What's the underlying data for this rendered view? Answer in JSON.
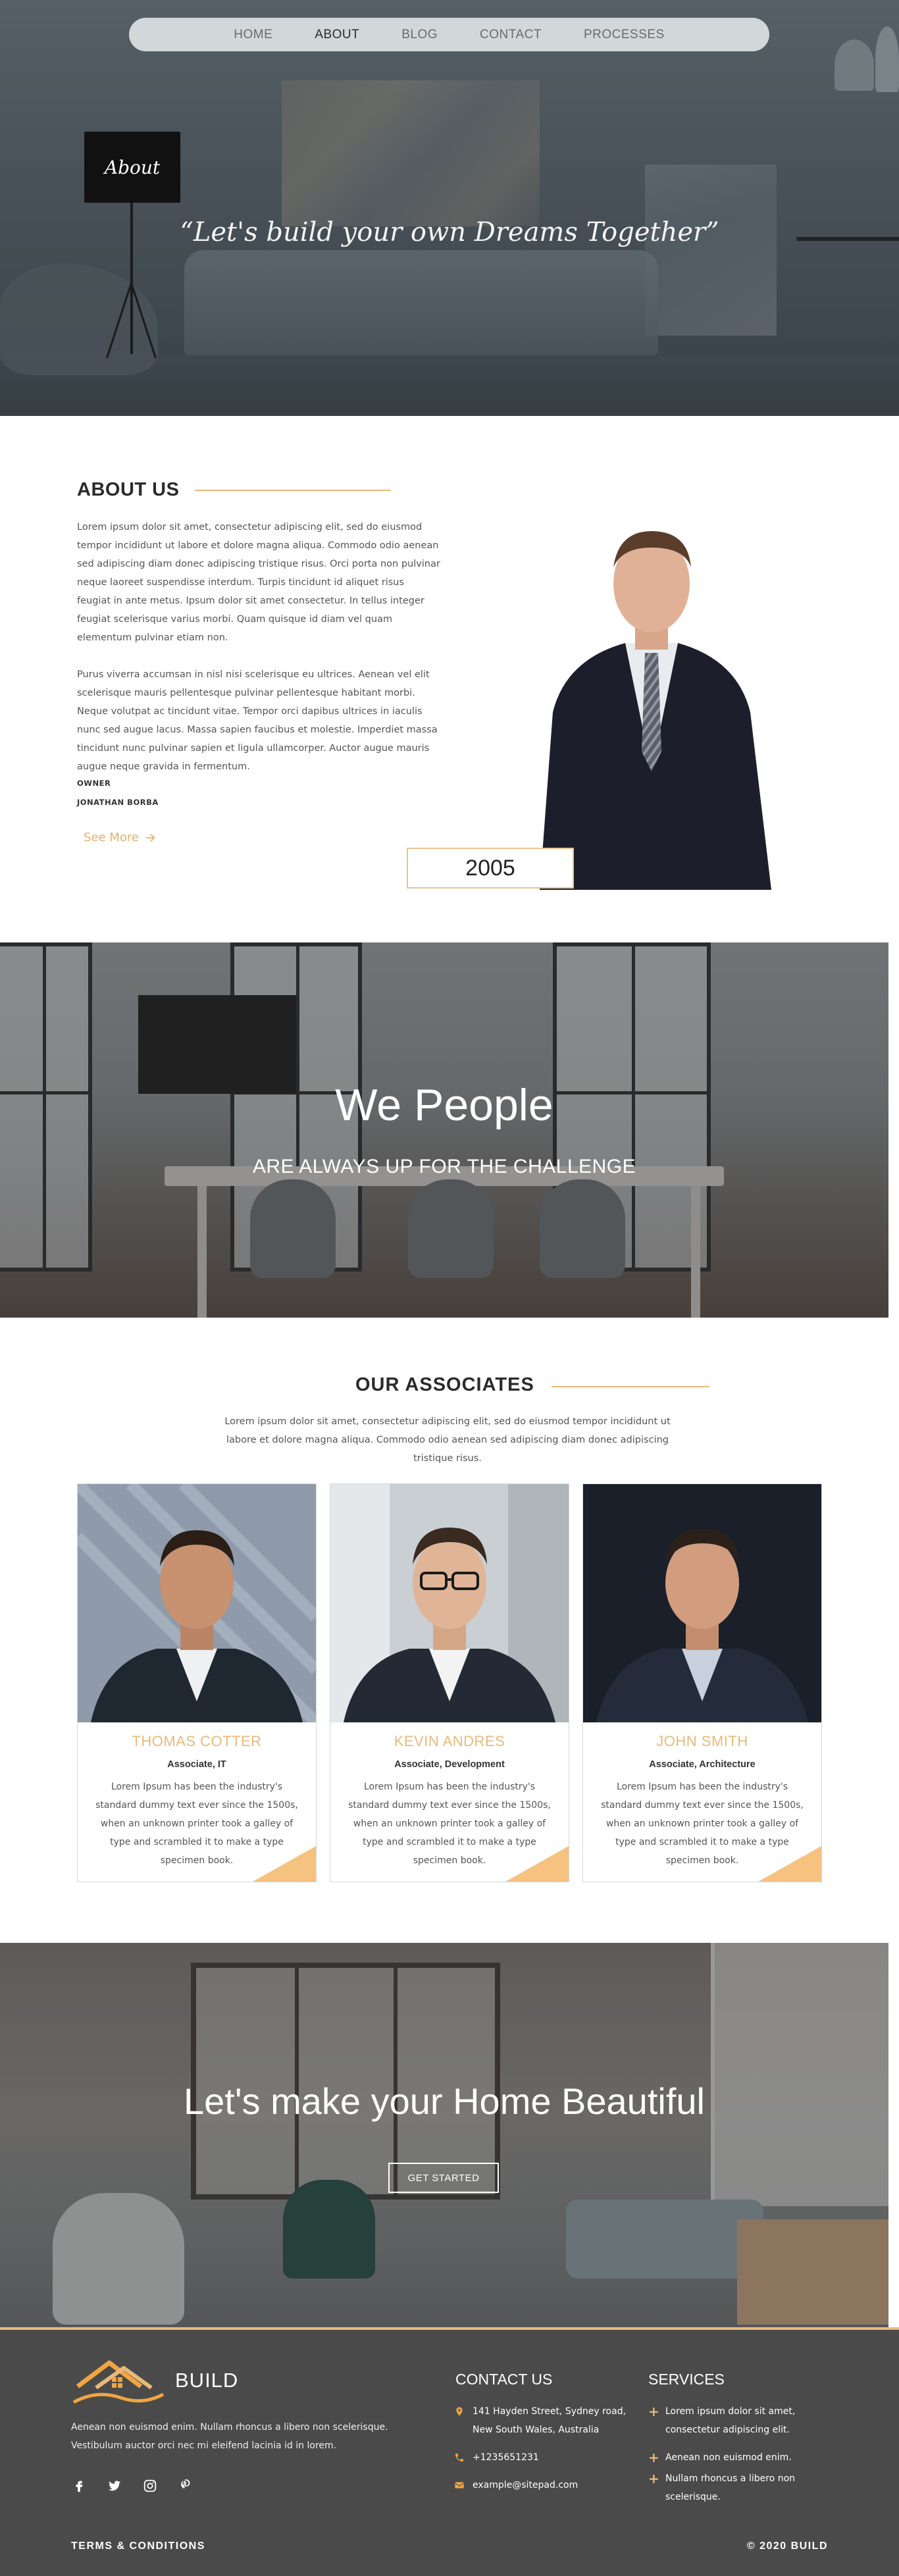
{
  "nav": {
    "items": [
      {
        "label": "HOME",
        "active": false
      },
      {
        "label": "ABOUT",
        "active": true
      },
      {
        "label": "BLOG",
        "active": false
      },
      {
        "label": "CONTACT",
        "active": false
      },
      {
        "label": "PROCESSES",
        "active": false
      }
    ]
  },
  "hero": {
    "sign": "About",
    "quote": "“Let's build your own Dreams Together”"
  },
  "about": {
    "title": "ABOUT US",
    "paragraph1": "Lorem ipsum dolor sit amet, consectetur adipiscing elit, sed do eiusmod tempor incididunt ut labore et dolore magna aliqua. Commodo odio aenean sed adipiscing diam donec adipiscing tristique risus. Orci porta non pulvinar neque laoreet suspendisse interdum. Turpis tincidunt id aliquet risus feugiat in ante metus. Ipsum dolor sit amet consectetur. In tellus integer feugiat scelerisque varius morbi. Quam quisque id diam vel quam elementum pulvinar etiam non.",
    "paragraph2": "Purus viverra accumsan in nisl nisi scelerisque eu ultrices. Aenean vel elit scelerisque mauris pellentesque pulvinar pellentesque habitant morbi. Neque volutpat ac tincidunt vitae. Tempor orci dapibus ultrices in iaculis nunc sed augue lacus. Massa sapien faucibus et molestie. Imperdiet massa tincidunt nunc pulvinar sapien et ligula ullamcorper. Auctor augue mauris augue neque gravida in fermentum.",
    "owner_label": "OWNER",
    "owner_name": "JONATHAN BORBA",
    "see_more": "See More",
    "year": "2005"
  },
  "people": {
    "title": "We People",
    "subtitle": "ARE ALWAYS UP FOR THE CHALLENGE"
  },
  "associates": {
    "title": "OUR ASSOCIATES",
    "intro": "Lorem ipsum dolor sit amet, consectetur adipiscing elit, sed do eiusmod tempor incididunt ut labore et dolore magna aliqua. Commodo odio aenean sed adipiscing diam donec adipiscing tristique risus.",
    "members": [
      {
        "name": "THOMAS COTTER",
        "role": "Associate, IT",
        "desc": "Lorem Ipsum has been the industry's standard dummy text ever since the 1500s, when an unknown printer took a galley of type and scrambled it to make a type specimen book."
      },
      {
        "name": "KEVIN ANDRES",
        "role": "Associate, Development",
        "desc": "Lorem Ipsum has been the industry's standard dummy text ever since the 1500s, when an unknown printer took a galley of type and scrambled it to make a type specimen book."
      },
      {
        "name": "JOHN SMITH",
        "role": "Associate, Architecture",
        "desc": "Lorem Ipsum has been the industry's standard dummy text ever since the 1500s, when an unknown printer took a galley of type and scrambled it to make a type specimen book."
      }
    ]
  },
  "cta": {
    "title": "Let's make your Home Beautiful",
    "button": "GET STARTED"
  },
  "footer": {
    "brand": "BUILD",
    "about": "Aenean non euismod enim. Nullam rhoncus a libero non scelerisque. Vestibulum auctor orci nec mi eleifend lacinia id in lorem.",
    "socials": [
      "facebook-icon",
      "twitter-icon",
      "instagram-icon",
      "pinterest-icon"
    ],
    "contact_title": "CONTACT US",
    "address": "141 Hayden Street, Sydney road, New South Wales, Australia",
    "phone": "+1235651231",
    "email": "example@sitepad.com",
    "services_title": "SERVICES",
    "services": [
      "Lorem ipsum dolor sit amet, consectetur adipiscing elit.",
      "Aenean non euismod enim.",
      "Nullam rhoncus a libero non scelerisque."
    ],
    "terms": "TERMS & CONDITIONS",
    "copyright": "© 2020 BUILD"
  },
  "colors": {
    "accent": "#e9b97a",
    "footer_bg": "#4a4a4a"
  }
}
